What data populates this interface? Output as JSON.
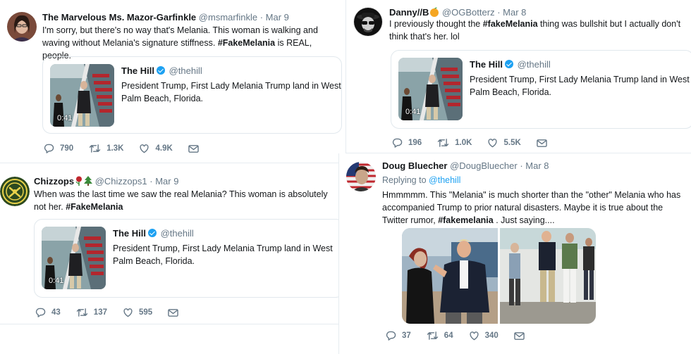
{
  "tweets": [
    {
      "name": "The Marvelous Ms. Mazor-Garfinkle",
      "handle": "@msmarfinkle",
      "date": "Mar 9",
      "text_pre": "I'm sorry, but there's no way that's Melania. This woman is walking and waving without Melania's signature stiffness. ",
      "hashtag": "#FakeMelania",
      "text_post": " is REAL, people.",
      "card": {
        "name": "The Hill",
        "handle": "@thehill",
        "text": "President Trump, First Lady Melania Trump land in West Palm Beach, Florida.",
        "duration": "0:41"
      },
      "replies": "790",
      "retweets": "1.3K",
      "likes": "4.9K"
    },
    {
      "name": "Danny//B",
      "handle": "@OGBotterz",
      "date": "Mar 8",
      "text_pre": "I previously thought the ",
      "hashtag": "#fakeMelania",
      "text_post": " thing was bullshit but I actually don't think that's her. lol",
      "card": {
        "name": "The Hill",
        "handle": "@thehill",
        "text": "President Trump, First Lady Melania Trump land in West Palm Beach, Florida.",
        "duration": "0:41"
      },
      "replies": "196",
      "retweets": "1.0K",
      "likes": "5.5K"
    },
    {
      "name": "Chizzops",
      "handle": "@Chizzops1",
      "date": "Mar 9",
      "text_pre": "When was the last time we saw the real Melania? This woman is absolutely not her. ",
      "hashtag": "#FakeMelania",
      "text_post": "",
      "card": {
        "name": "The Hill",
        "handle": "@thehill",
        "text": "President Trump, First Lady Melania Trump land in West Palm Beach, Florida.",
        "duration": "0:41"
      },
      "replies": "43",
      "retweets": "137",
      "likes": "595"
    },
    {
      "name": "Doug Bluecher",
      "handle": "@DougBluecher",
      "date": "Mar 8",
      "reply_label": "Replying to",
      "reply_mention": "@thehill",
      "text_pre": "Hmmmmm. This \"Melania\" is much shorter than the \"other\" Melania who has accompanied Trump to prior natural disasters. Maybe it is true about the Twitter rumor, ",
      "hashtag": "#fakemelania",
      "text_post": " . Just saying....",
      "replies": "37",
      "retweets": "64",
      "likes": "340"
    }
  ],
  "separator": "·",
  "icons": {
    "reply": "reply-icon",
    "retweet": "retweet-icon",
    "like": "heart-icon",
    "dm": "envelope-icon",
    "verified": "verified-badge-icon"
  },
  "colors": {
    "text": "#14171a",
    "muted": "#657786",
    "link": "#1da1f2",
    "border": "#e6ecf0"
  }
}
